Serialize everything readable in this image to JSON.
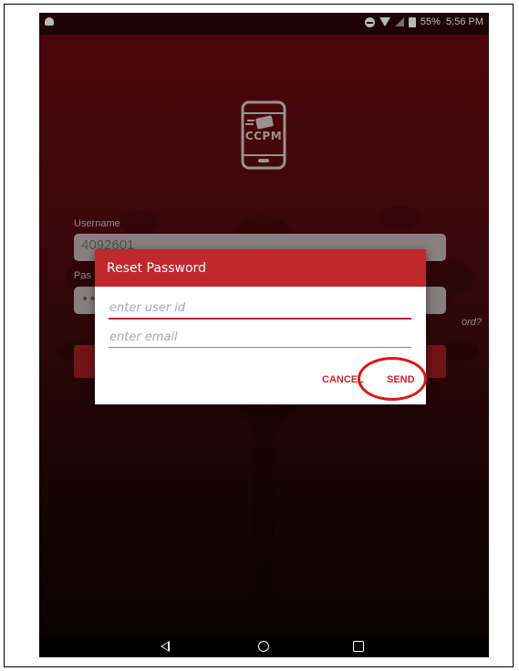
{
  "status_bar": {
    "battery": "55%",
    "time": "5:56 PM",
    "icons": [
      "android-icon",
      "dnd-icon",
      "wifi-icon",
      "signal-icon",
      "battery-icon"
    ]
  },
  "logo": {
    "text": "CCPM",
    "icon": "phone-card-icon"
  },
  "login": {
    "username_label": "Username",
    "username_value": "4092601",
    "password_label": "Pas",
    "password_value": "••",
    "forgot_text": "ord?"
  },
  "dialog": {
    "title": "Reset Password",
    "user_id_placeholder": "enter user id",
    "email_placeholder": "enter email",
    "cancel_label": "CANCEL",
    "send_label": "SEND"
  },
  "colors": {
    "accent": "#c1272d",
    "background_top": "#6a0a0f",
    "background_bottom": "#0c0303",
    "annotation": "#e01515"
  },
  "nav_bar": {
    "icons": [
      "back-icon",
      "home-icon",
      "recents-icon"
    ]
  }
}
